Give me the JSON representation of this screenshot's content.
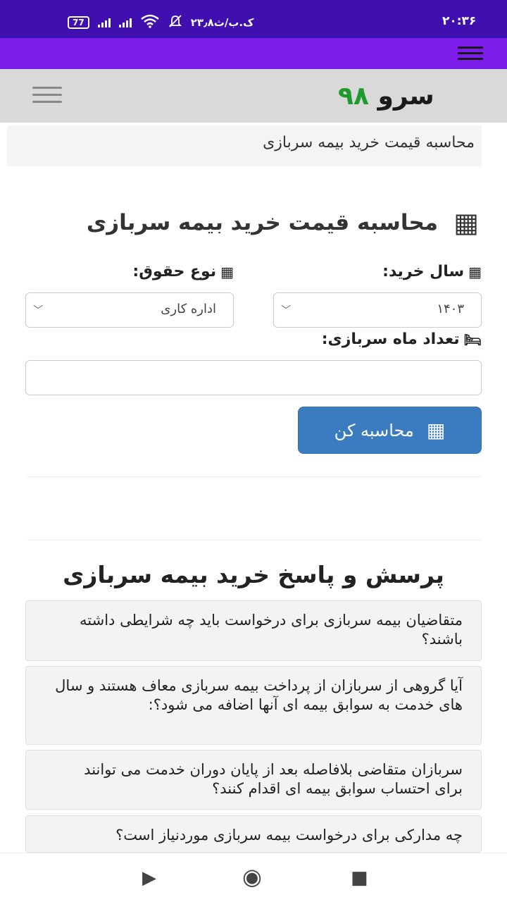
{
  "status_bar": {
    "time": "۲۰:۳۶",
    "battery": "77",
    "temperature": "۲۳٫۸ک.ب/ث",
    "icons": [
      "battery-icon",
      "signal-icon",
      "signal-icon",
      "wifi-icon",
      "mute-icon"
    ]
  },
  "site": {
    "logo_part1": "سرو",
    "logo_part2": "۹۸",
    "brand_green": "#1f9a2e"
  },
  "breadcrumb": "محاسبه قیمت خرید بیمه سربازی",
  "calculator": {
    "title": "محاسبه قیمت خرید بیمه سربازی",
    "year_label": "سال خرید:",
    "year_value": "۱۴۰۳",
    "salary_label": "نوع حقوق:",
    "salary_value": "اداره کاری",
    "months_label": "تعداد ماه سربازی:",
    "months_value": "",
    "button_label": "محاسبه کن",
    "button_color": "#3b7cc0"
  },
  "faq": {
    "title": "پرسش و پاسخ خرید بیمه سربازی",
    "items": [
      "متقاضیان بیمه سربازی برای درخواست باید چه شرایطی داشته باشند؟",
      "آیا گروهی از سربازان از پرداخت بیمه سربازی معاف هستند و سال های خدمت به سوابق بیمه ای آنها اضافه می شود؟:",
      "سربازان متقاضی بلافاصله بعد از پایان دوران خدمت می توانند برای احتساب سوابق بیمه ای اقدام کنند؟",
      "چه مدارکی برای درخواست بیمه سربازی موردنیاز است؟"
    ]
  },
  "nav": {
    "back": "▶",
    "home": "◉",
    "recents": "■"
  }
}
